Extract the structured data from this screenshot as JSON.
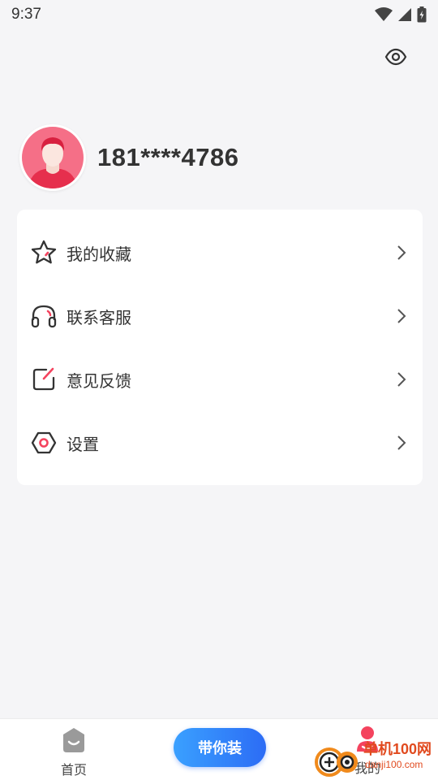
{
  "status_bar": {
    "time": "9:37"
  },
  "profile": {
    "username": "181****4786"
  },
  "menu": {
    "items": [
      {
        "label": "我的收藏",
        "icon": "star-icon"
      },
      {
        "label": "联系客服",
        "icon": "headset-icon"
      },
      {
        "label": "意见反馈",
        "icon": "edit-note-icon"
      },
      {
        "label": "设置",
        "icon": "settings-hexagon-icon"
      }
    ]
  },
  "bottom_nav": {
    "home_label": "首页",
    "center_label": "带你装",
    "mine_label": "我的"
  },
  "watermark": {
    "name": "单机100网",
    "url": "danji100.com"
  },
  "colors": {
    "accent_pink": "#f4435e",
    "center_button": "#2c6cf5",
    "background": "#f5f5f7"
  }
}
